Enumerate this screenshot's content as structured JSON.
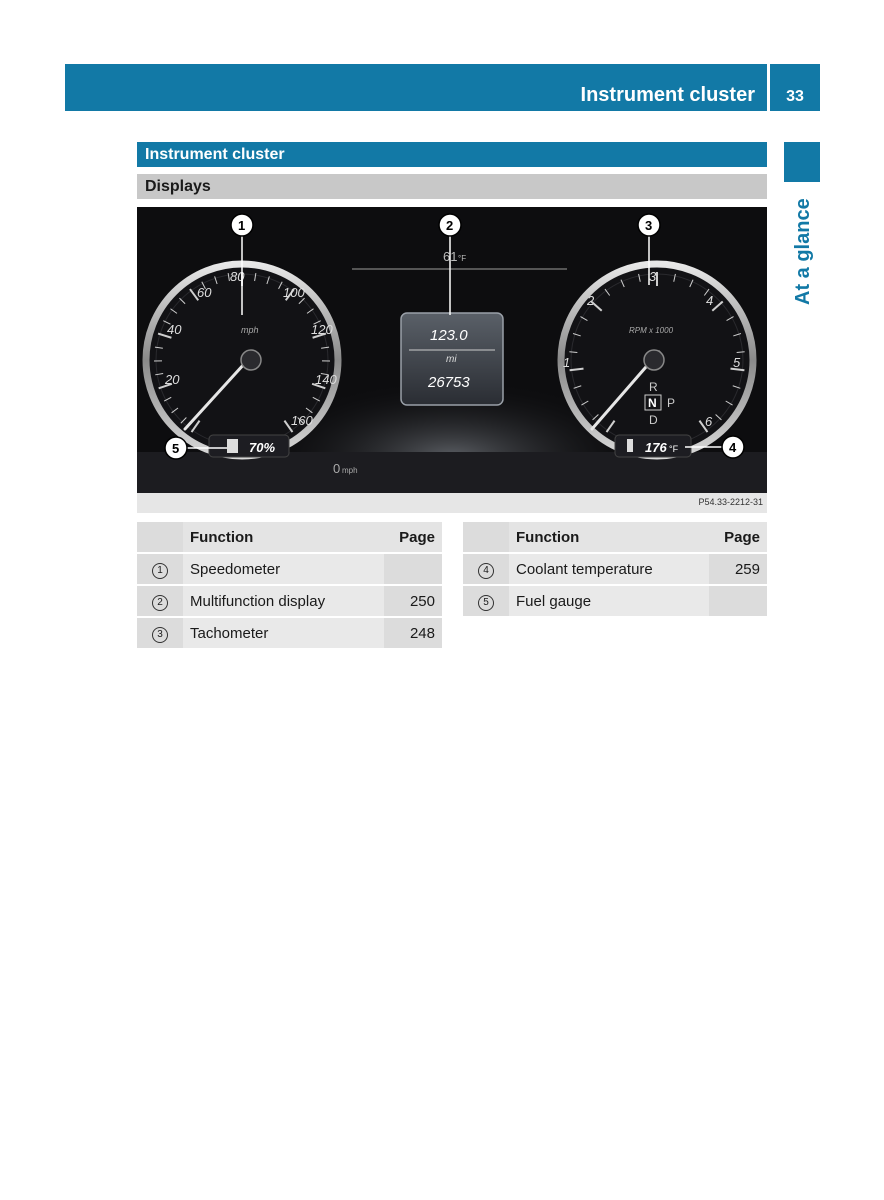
{
  "header": {
    "title": "Instrument cluster",
    "page_number": "33"
  },
  "side_tab": {
    "label": "At a glance"
  },
  "section": {
    "title": "Instrument cluster",
    "subtitle": "Displays"
  },
  "figure": {
    "image_code": "P54.33-2212-31",
    "callouts": [
      "1",
      "2",
      "3",
      "4",
      "5"
    ],
    "speedometer": {
      "unit": "mph",
      "ticks": [
        "20",
        "40",
        "60",
        "80",
        "100",
        "120",
        "140",
        "160"
      ]
    },
    "tachometer": {
      "unit": "RPM x 1000",
      "ticks": [
        "1",
        "2",
        "3",
        "4",
        "5",
        "6"
      ]
    },
    "outside_temp": "61",
    "outside_temp_unit": "°F",
    "mfd": {
      "top_value": "123.0",
      "unit": "mi",
      "bottom_value": "26753"
    },
    "speed_readout": "0",
    "speed_readout_unit": "mph",
    "fuel": "70%",
    "coolant": "176",
    "coolant_unit": "°F",
    "gears": {
      "r": "R",
      "n": "N",
      "p": "P",
      "d": "D"
    }
  },
  "table_left": {
    "headers": {
      "num": "",
      "function": "Function",
      "page": "Page"
    },
    "rows": [
      {
        "num": "1",
        "function": "Speedometer",
        "page": ""
      },
      {
        "num": "2",
        "function": "Multifunction display",
        "page": "250"
      },
      {
        "num": "3",
        "function": "Tachometer",
        "page": "248"
      }
    ]
  },
  "table_right": {
    "headers": {
      "num": "",
      "function": "Function",
      "page": "Page"
    },
    "rows": [
      {
        "num": "4",
        "function": "Coolant temperature",
        "page": "259"
      },
      {
        "num": "5",
        "function": "Fuel gauge",
        "page": ""
      }
    ]
  }
}
